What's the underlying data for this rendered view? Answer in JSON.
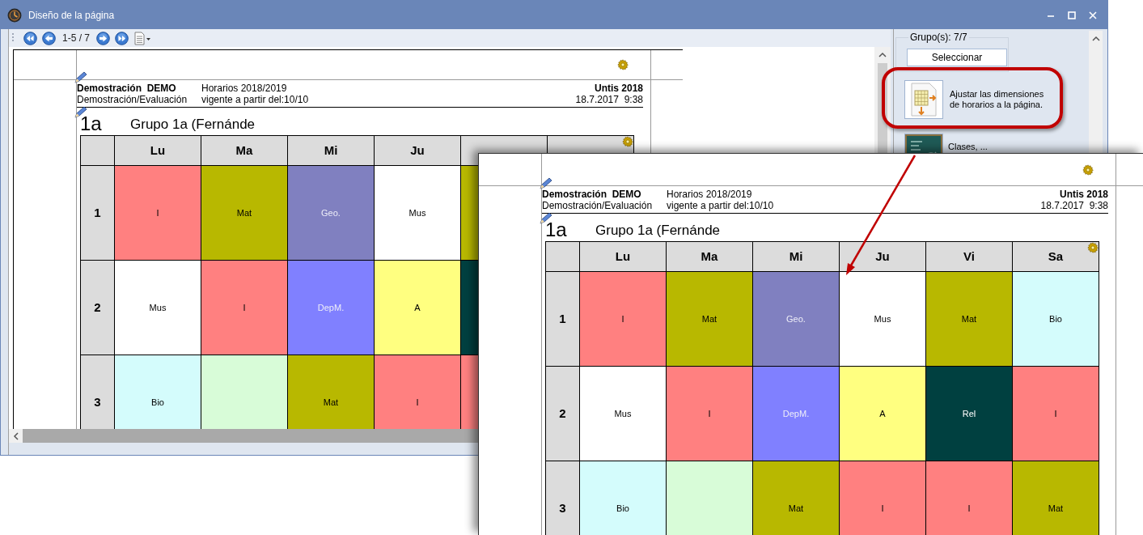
{
  "window": {
    "title": "Diseño de la página"
  },
  "toolbar": {
    "page_range": "1-5 / 7"
  },
  "preview_page": {
    "header": {
      "school": "Demostración  DEMO",
      "license": "Demostración/Evaluación",
      "timetable": "Horarios 2018/2019",
      "valid_from": "vigente a partir del:10/10",
      "product": "Untis 2018",
      "printed": "18.7.2017  9:38"
    },
    "class_short": "1a",
    "title": "Grupo 1a (Fernánde",
    "days": [
      "Lu",
      "Ma",
      "Mi",
      "Ju"
    ],
    "periods": [
      {
        "number": "1",
        "cells": [
          {
            "subject": "I",
            "color": "#ff8080"
          },
          {
            "subject": "Mat",
            "color": "#b8b800"
          },
          {
            "subject": "Geo.",
            "color": "#8080c0"
          },
          {
            "subject": "Mus",
            "color": "#ffffff"
          },
          {
            "color": "#b8b800"
          }
        ]
      },
      {
        "number": "2",
        "cells": [
          {
            "subject": "Mus",
            "color": "#ffffff"
          },
          {
            "subject": "I",
            "color": "#ff8080"
          },
          {
            "subject": "DepM.",
            "color": "#8080ff"
          },
          {
            "subject": "A",
            "color": "#ffff80"
          },
          {
            "color": "#004040"
          }
        ]
      },
      {
        "number": "3",
        "cells": [
          {
            "subject": "Bio",
            "color": "#d4fcfc"
          },
          {
            "color": "#d8fcd8"
          },
          {
            "subject": "Mat",
            "color": "#b8b800"
          },
          {
            "subject": "I",
            "color": "#ff8080"
          },
          {
            "color": "#ff8080"
          }
        ]
      }
    ]
  },
  "side_panel": {
    "group_label": "Grupo(s): 7/7",
    "select_button": "Seleccionar",
    "actions": [
      {
        "kind": "fit",
        "label": "Ajustar las dimensiones de horarios a la página.",
        "highlighted": true
      },
      {
        "kind": "classes",
        "label": "Clases, ...",
        "highlighted": false
      }
    ]
  },
  "enlarged_page": {
    "header": {
      "school": "Demostración  DEMO",
      "license": "Demostración/Evaluación",
      "timetable": "Horarios 2018/2019",
      "valid_from": "vigente a partir del:10/10",
      "product": "Untis 2018",
      "printed": "18.7.2017  9:38"
    },
    "class_short": "1a",
    "title": "Grupo 1a (Fernánde",
    "days": [
      "Lu",
      "Ma",
      "Mi",
      "Ju",
      "Vi",
      "Sa"
    ],
    "periods": [
      {
        "number": "1",
        "cells": [
          {
            "subject": "I",
            "color": "#ff8080"
          },
          {
            "subject": "Mat",
            "color": "#b8b800"
          },
          {
            "subject": "Geo.",
            "color": "#8080c0"
          },
          {
            "subject": "Mus",
            "color": "#ffffff"
          },
          {
            "subject": "Mat",
            "color": "#b8b800"
          },
          {
            "subject": "Bio",
            "color": "#d4fcfc"
          }
        ]
      },
      {
        "number": "2",
        "cells": [
          {
            "subject": "Mus",
            "color": "#ffffff"
          },
          {
            "subject": "I",
            "color": "#ff8080"
          },
          {
            "subject": "DepM.",
            "color": "#8080ff"
          },
          {
            "subject": "A",
            "color": "#ffff80"
          },
          {
            "subject": "Rel",
            "color": "#004040"
          },
          {
            "subject": "I",
            "color": "#ff8080"
          }
        ]
      },
      {
        "number": "3",
        "cells": [
          {
            "subject": "Bio",
            "color": "#d4fcfc"
          },
          {
            "color": "#d8fcd8"
          },
          {
            "subject": "Mat",
            "color": "#b8b800"
          },
          {
            "subject": "I",
            "color": "#ff8080"
          },
          {
            "subject": "I",
            "color": "#ff8080"
          },
          {
            "subject": "Mat",
            "color": "#b8b800"
          }
        ]
      }
    ]
  }
}
